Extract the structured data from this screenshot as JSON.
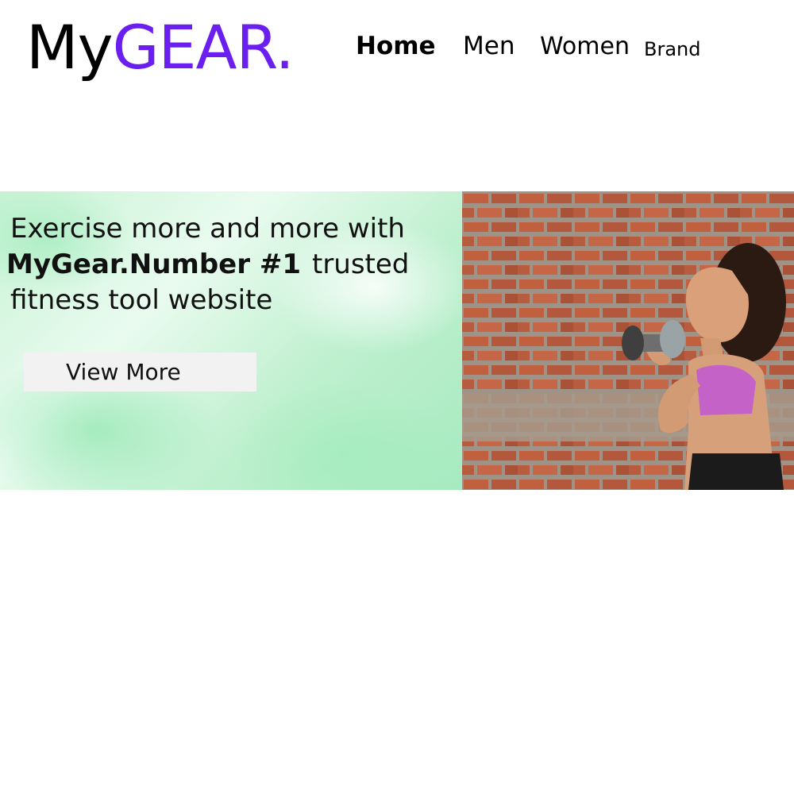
{
  "header": {
    "logo": {
      "part1": "My",
      "part2": "GEAR."
    },
    "nav": [
      {
        "label": "Home",
        "active": true
      },
      {
        "label": "Men",
        "active": false
      },
      {
        "label": "Women",
        "active": false
      },
      {
        "label": "Brand",
        "active": false
      }
    ]
  },
  "hero": {
    "headline": {
      "line1": "Exercise more and more with",
      "line2_bold": "MyGear.Number #1",
      "line2_rest": "trusted",
      "line3": "fitness tool website"
    },
    "cta_label": "View More",
    "image_subject": "woman lifting dumbbell in front of red brick wall"
  },
  "colors": {
    "brand_accent": "#6a1ff0",
    "hero_background": "#c7f3d4",
    "button_background": "#f2f2f2",
    "brick": "#b4583d"
  }
}
